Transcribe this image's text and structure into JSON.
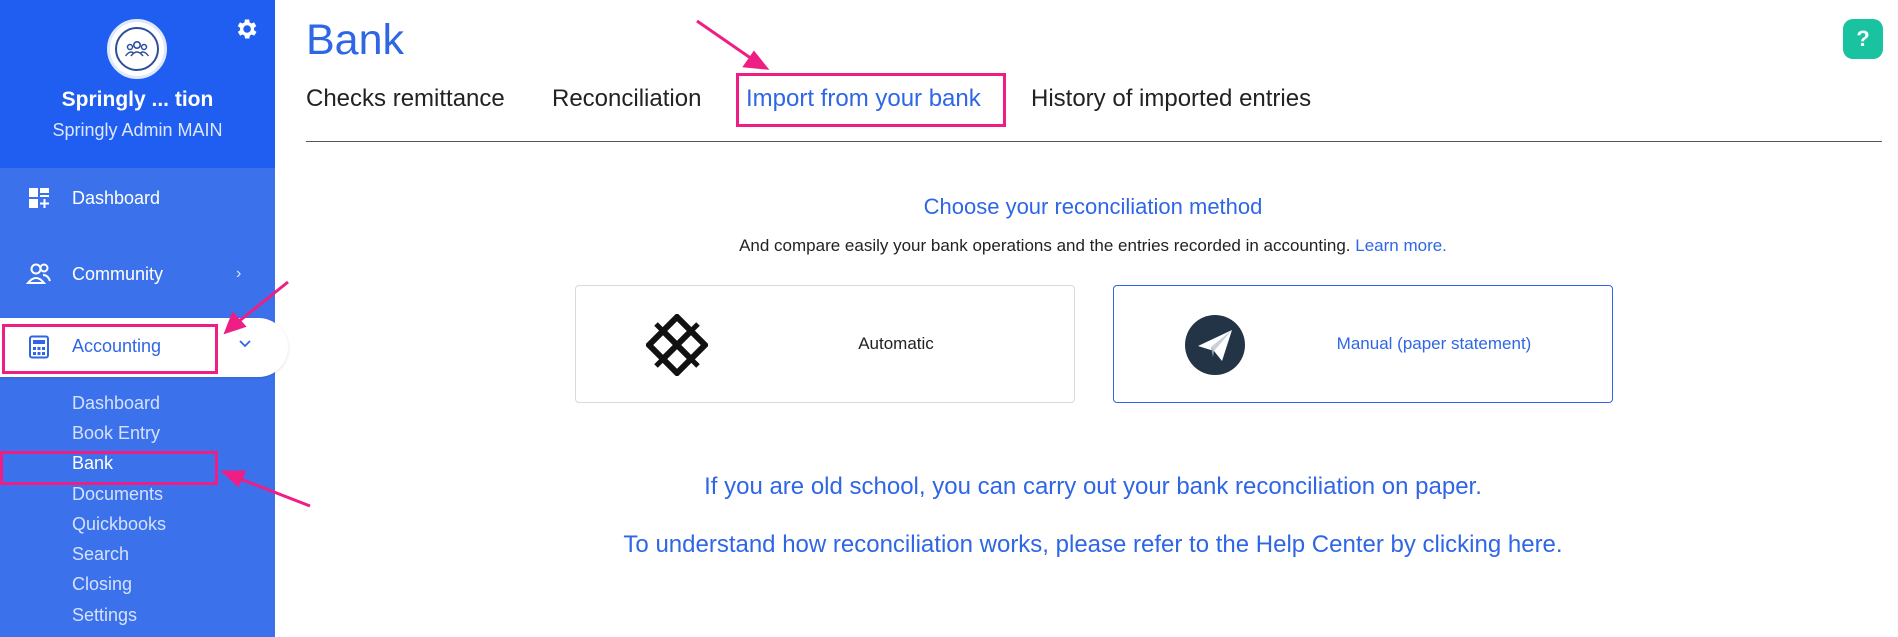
{
  "sidebar": {
    "org_name": "Springly ...  tion",
    "org_sub": "Springly Admin MAIN",
    "nav": [
      {
        "label": "Dashboard",
        "icon": "dashboard-icon"
      },
      {
        "label": "Community",
        "icon": "community-icon",
        "chevron": "›"
      },
      {
        "label": "Accounting",
        "icon": "calculator-icon",
        "chevron": "⌄"
      }
    ],
    "accounting_sub": [
      "Dashboard",
      "Book Entry",
      "Bank",
      "Documents",
      "Quickbooks",
      "Search",
      "Closing",
      "Settings"
    ],
    "current_sub": "Bank"
  },
  "page": {
    "title": "Bank",
    "help_label": "?"
  },
  "tabs": [
    "Checks remittance",
    "Reconciliation",
    "Import from your bank",
    "History of imported entries"
  ],
  "active_tab": "Import from your bank",
  "method": {
    "title": "Choose your reconciliation method",
    "subtitle": "And compare easily your bank operations and the entries recorded in accounting.",
    "learn_more": "Learn more.",
    "options": [
      {
        "label": "Automatic",
        "icon": "lattice-logo-icon",
        "selected": false
      },
      {
        "label": "Manual (paper statement)",
        "icon": "paper-plane-icon",
        "selected": true
      }
    ]
  },
  "bottom": {
    "paper_line": "If you are old school, you can carry out your bank reconciliation on paper.",
    "help_line": "To understand how reconciliation works, please refer to the Help Center by clicking here."
  },
  "colors": {
    "brand_blue": "#2f66e6",
    "sidebar_blue": "#3b72ec",
    "sidebar_header": "#1f5ef0",
    "help_green": "#19c39f",
    "annotation_pink": "#ee1e85"
  }
}
